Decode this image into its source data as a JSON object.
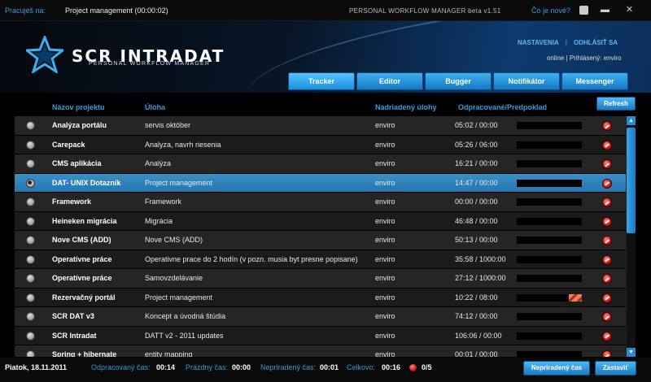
{
  "topbar": {
    "working_on_label": "Pracuješ na:",
    "current_task": "Project management (00:00:02)",
    "app_version": "PERSONAL WORKFLOW MANAGER beta v1.51",
    "whats_new": "Čo je nové?"
  },
  "header": {
    "logo_text": "SCR INTRADAT",
    "logo_subtitle": "PERSONAL WORKFLOW MANAGER",
    "settings_link": "NASTAVENIA",
    "separator": "|",
    "logout_link": "ODHLÁSIŤ SA",
    "status_online": "online",
    "logged_in_label": "Prihlásený: enviro"
  },
  "tabs": [
    {
      "label": "Tracker",
      "active": true
    },
    {
      "label": "Editor",
      "active": false
    },
    {
      "label": "Bugger",
      "active": false
    },
    {
      "label": "Notifikátor",
      "active": false
    },
    {
      "label": "Messenger",
      "active": false
    }
  ],
  "columns": {
    "project": "Názov projektu",
    "task": "Úloha",
    "parent": "Nadriadený úlohy",
    "time": "Odpracované/Predpoklad"
  },
  "refresh_label": "Refresh",
  "rows": [
    {
      "project": "Analýza portálu",
      "task": "servis október",
      "parent": "enviro",
      "time": "05:02 / 00:00",
      "progress": 1.0,
      "over": 0,
      "selected": false
    },
    {
      "project": "Carepack",
      "task": "Analyza, navrh riesenia",
      "parent": "enviro",
      "time": "05:26 / 06:00",
      "progress": 0.9,
      "over": 0,
      "selected": false
    },
    {
      "project": "CMS aplikácia",
      "task": "Analýza",
      "parent": "enviro",
      "time": "16:21 / 00:00",
      "progress": 1.0,
      "over": 0,
      "selected": false
    },
    {
      "project": "DAT- UNIX Dotazník",
      "task": "Project management",
      "parent": "enviro",
      "time": "14:47 / 00:00",
      "progress": 1.0,
      "over": 0,
      "selected": true
    },
    {
      "project": "Framework",
      "task": "Framework",
      "parent": "enviro",
      "time": "00:00 / 00:00",
      "progress": 1.0,
      "over": 0,
      "selected": false
    },
    {
      "project": "Heineken migrácia",
      "task": "Migrácia",
      "parent": "enviro",
      "time": "46:48 / 00:00",
      "progress": 1.0,
      "over": 0,
      "selected": false
    },
    {
      "project": "Nove CMS (ADD)",
      "task": "Nove CMS (ADD)",
      "parent": "enviro",
      "time": "50:13 / 00:00",
      "progress": 1.0,
      "over": 0,
      "selected": false
    },
    {
      "project": "Operatívne práce",
      "task": "Operativne prace do 2 hodín (v pozn. musia byt presne popisane)",
      "parent": "enviro",
      "time": "35:58 / 1000:00",
      "progress": 0.04,
      "over": 0,
      "selected": false
    },
    {
      "project": "Operatívne práce",
      "task": "Samovzdelávanie",
      "parent": "enviro",
      "time": "27:12 / 1000:00",
      "progress": 0.03,
      "over": 0,
      "selected": false
    },
    {
      "project": "Rezervačný portál",
      "task": "Project management",
      "parent": "enviro",
      "time": "10:22 / 08:00",
      "progress": 0.8,
      "over": 0.2,
      "selected": false
    },
    {
      "project": "SCR DAT v3",
      "task": "Koncept a úvodná štúdia",
      "parent": "enviro",
      "time": "74:12 / 00:00",
      "progress": 1.0,
      "over": 0,
      "selected": false
    },
    {
      "project": "SCR Intradat",
      "task": "DATT v2 - 2011 updates",
      "parent": "enviro",
      "time": "106:06 / 00:00",
      "progress": 1.0,
      "over": 0,
      "selected": false
    },
    {
      "project": "Spring + hibernate",
      "task": "entity mapping",
      "parent": "enviro",
      "time": "00:01 / 00:00",
      "progress": 1.0,
      "over": 0,
      "selected": false
    }
  ],
  "footer": {
    "date": "Piatok, 18.11.2011",
    "worked_label": "Odpracovaný čas:",
    "worked_value": "00:14",
    "empty_label": "Prázdny čas:",
    "empty_value": "00:00",
    "unassigned_label": "Nepriradený čas:",
    "unassigned_value": "00:01",
    "total_label": "Celkovo:",
    "total_value": "00:16",
    "ratio": "0/5",
    "unassigned_button": "Nepriradený čas",
    "stop_button": "Zastaviť"
  }
}
